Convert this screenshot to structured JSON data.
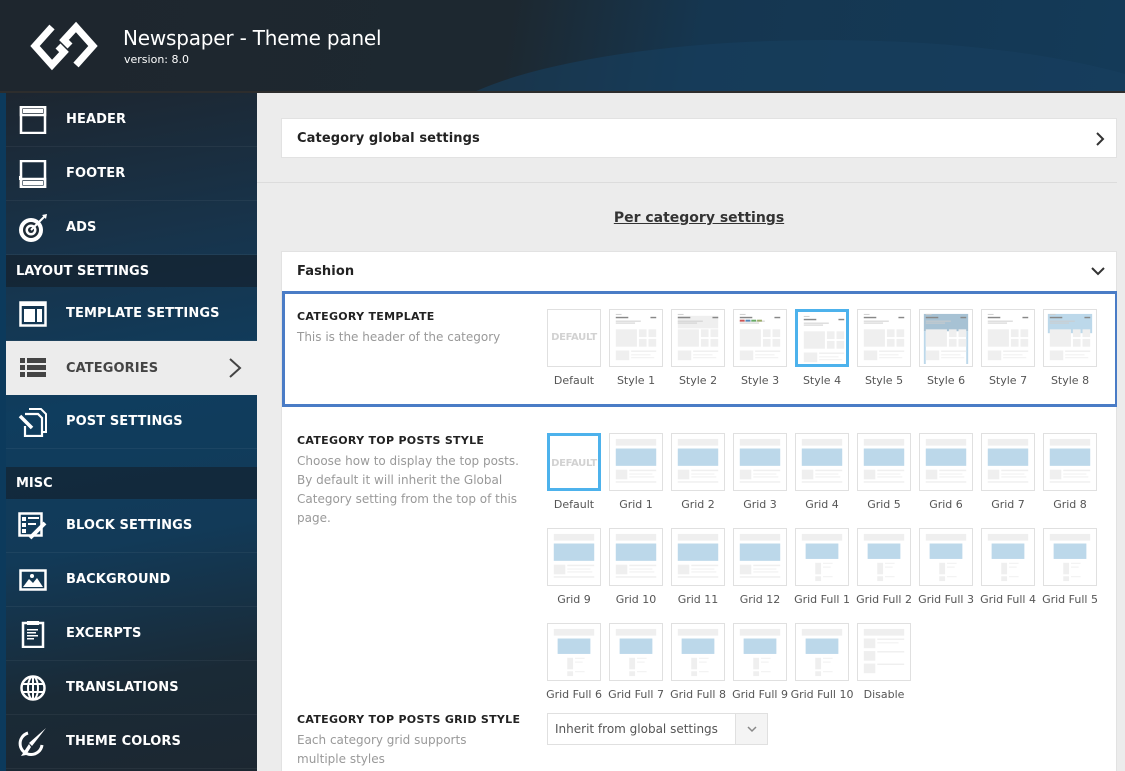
{
  "app": {
    "title": "Newspaper - Theme panel",
    "version": "version: 8.0"
  },
  "sidebar": {
    "items": [
      {
        "label": "HEADER",
        "icon": "header-icon"
      },
      {
        "label": "FOOTER",
        "icon": "footer-icon"
      },
      {
        "label": "ADS",
        "icon": "target-icon"
      }
    ],
    "section_layout": "LAYOUT SETTINGS",
    "layout_items": [
      {
        "label": "TEMPLATE SETTINGS",
        "icon": "template-icon"
      },
      {
        "label": "CATEGORIES",
        "icon": "list-icon",
        "active": true
      },
      {
        "label": "POST SETTINGS",
        "icon": "post-edit-icon"
      }
    ],
    "section_misc": "MISC",
    "misc_items": [
      {
        "label": "BLOCK SETTINGS",
        "icon": "block-edit-icon"
      },
      {
        "label": "BACKGROUND",
        "icon": "image-icon"
      },
      {
        "label": "EXCERPTS",
        "icon": "clipboard-icon"
      },
      {
        "label": "TRANSLATIONS",
        "icon": "globe-icon"
      },
      {
        "label": "THEME COLORS",
        "icon": "brush-icon"
      }
    ]
  },
  "main": {
    "global_settings": "Category global settings",
    "per_category_heading": "Per category settings",
    "category_name": "Fashion",
    "category_template": {
      "title": "CATEGORY TEMPLATE",
      "description": "This is the header of the category",
      "default_text": "DEFAULT",
      "selected": "Style 4",
      "options": [
        "Default",
        "Style 1",
        "Style 2",
        "Style 3",
        "Style 4",
        "Style 5",
        "Style 6",
        "Style 7",
        "Style 8"
      ]
    },
    "top_posts_style": {
      "title": "CATEGORY TOP POSTS STYLE",
      "description": "Choose how to display the top posts. By default it will inherit the Global Category setting from the top of this page.",
      "default_text": "DEFAULT",
      "selected": "Default",
      "options": [
        "Default",
        "Grid 1",
        "Grid 2",
        "Grid 3",
        "Grid 4",
        "Grid 5",
        "Grid 6",
        "Grid 7",
        "Grid 8",
        "Grid 9",
        "Grid 10",
        "Grid 11",
        "Grid 12",
        "Grid Full 1",
        "Grid Full 2",
        "Grid Full 3",
        "Grid Full 4",
        "Grid Full 5",
        "Grid Full 6",
        "Grid Full 7",
        "Grid Full 8",
        "Grid Full 9",
        "Grid Full 10",
        "Disable"
      ]
    },
    "top_posts_grid_style": {
      "title": "CATEGORY TOP POSTS GRID STYLE",
      "description": "Each category grid supports multiple styles",
      "value": "Inherit from global settings"
    }
  },
  "colors": {
    "accent_selected": "#4db2ec",
    "highlight_border": "#4a7cc6",
    "thumb_blue": "#bcd8ea"
  }
}
